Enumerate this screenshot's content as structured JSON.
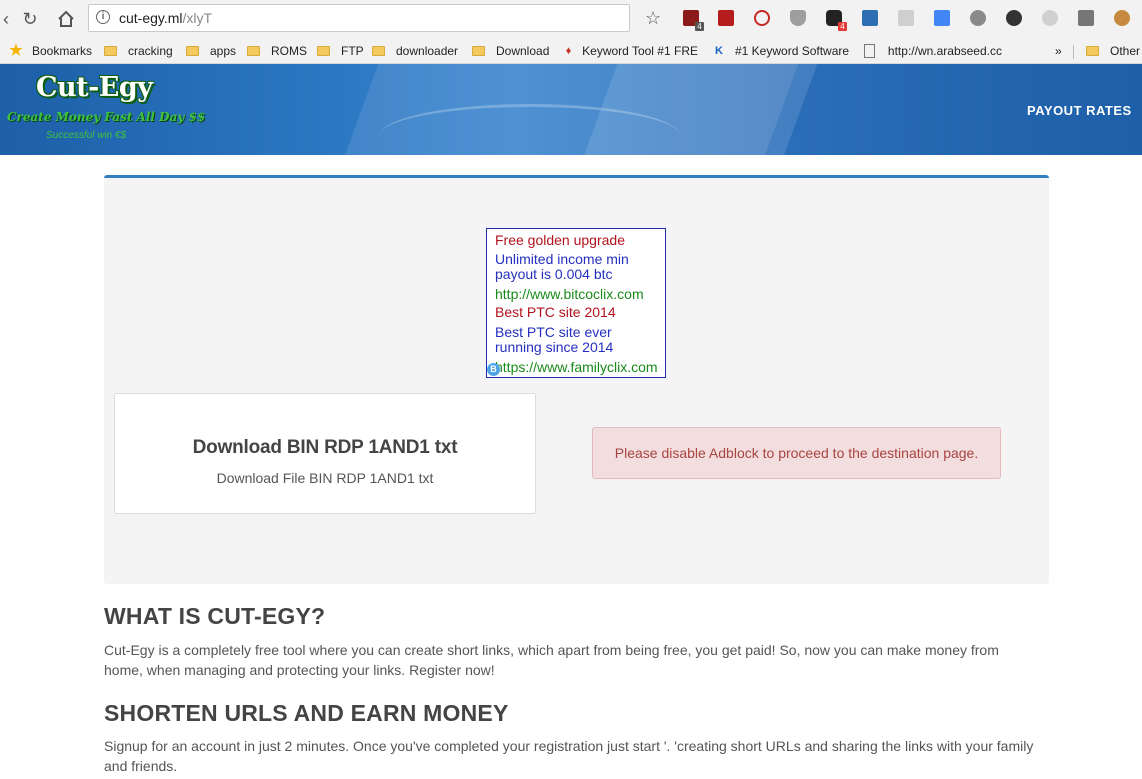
{
  "browser": {
    "url_host": "cut-egy.ml",
    "url_path": "/xlyT",
    "extension_badges": [
      "4",
      "4"
    ],
    "bookmarks": [
      {
        "label": "Bookmarks",
        "icon": "star-icon"
      },
      {
        "label": "cracking",
        "icon": "folder-icon"
      },
      {
        "label": "apps",
        "icon": "folder-icon"
      },
      {
        "label": "ROMS",
        "icon": "folder-icon"
      },
      {
        "label": "FTP",
        "icon": "folder-icon"
      },
      {
        "label": "downloader",
        "icon": "folder-icon"
      },
      {
        "label": "Download",
        "icon": "folder-icon"
      },
      {
        "label": "Keyword Tool #1 FRE",
        "icon": "flame-icon"
      },
      {
        "label": "#1 Keyword Software",
        "icon": "ks-icon"
      },
      {
        "label": "http://wn.arabseed.cc",
        "icon": "page-icon"
      },
      {
        "label": "Other",
        "icon": "folder-icon"
      }
    ],
    "overflow_label": "»"
  },
  "site": {
    "logo_text": "Cut-Egy",
    "tagline": "Create Money Fast All Day $$",
    "subline": "Successful win €$",
    "nav_payout": "PAYOUT RATES"
  },
  "ad": {
    "lines": [
      "Free golden upgrade",
      "Unlimited income min payout is 0.004 btc",
      "http://www.bitcoclix.com",
      "Best PTC site 2014",
      "Best PTC site ever running since 2014",
      "https://www.familyclix.com"
    ]
  },
  "file": {
    "title": "Download BIN RDP 1AND1 txt",
    "subtitle": "Download File BIN RDP 1AND1 txt"
  },
  "alert_text": "Please disable Adblock to proceed to the destination page.",
  "sections": [
    {
      "heading": "WHAT IS CUT-EGY?",
      "body": "Cut-Egy is a completely free tool where you can create short links, which apart from being free, you get paid! So, now you can make money from home, when managing and protecting your links. Register now!"
    },
    {
      "heading": "SHORTEN URLS AND EARN MONEY",
      "body": "Signup for an account in just 2 minutes. Once you've completed your registration just start '. 'creating short URLs and sharing the links with your family and friends."
    }
  ],
  "colors": {
    "accent": "#2f7fc1",
    "alert_bg": "#f2dede",
    "alert_text": "#a94442",
    "header_blue": "#2d78c3",
    "logo_green": "#3ec23e"
  }
}
